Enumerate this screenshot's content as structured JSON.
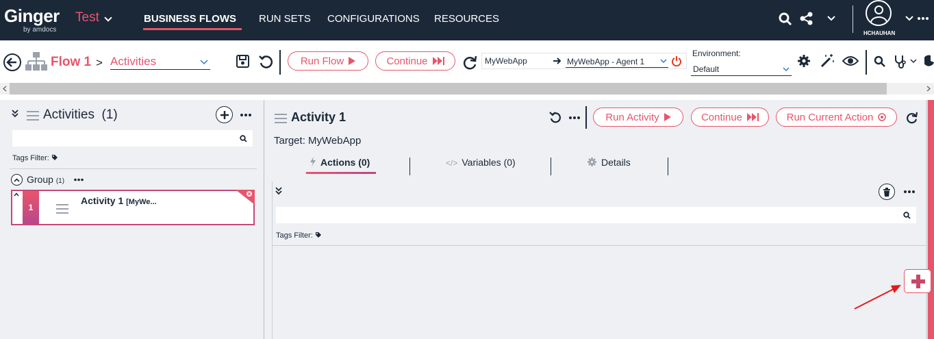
{
  "app": {
    "logo": "Ginger",
    "logo_sub": "by amdocs",
    "solution": "Test",
    "username": "HCHAUHAN",
    "accent": "#e8556b",
    "nav_bg": "#1b2838"
  },
  "nav": {
    "items": [
      "BUSINESS FLOWS",
      "RUN SETS",
      "CONFIGURATIONS",
      "RESOURCES"
    ],
    "active": "BUSINESS FLOWS"
  },
  "toolbar": {
    "flow_name": "Flow 1",
    "crumb_sep": ">",
    "view_select": "Activities",
    "run_flow": "Run Flow",
    "continue": "Continue",
    "target_app": "MyWebApp",
    "agent": "MyWebApp - Agent 1",
    "env_label": "Environment:",
    "env_value": "Default"
  },
  "activities_panel": {
    "title": "Activities",
    "count": "(1)",
    "tags_filter": "Tags Filter:",
    "group_name": "Group",
    "group_count": "(1)",
    "items": [
      {
        "number": "1",
        "name": "Activity 1",
        "target": "[MyWe..."
      }
    ]
  },
  "activity": {
    "title": "Activity 1",
    "target": "Target: MyWebApp",
    "run_activity": "Run Activity",
    "continue": "Continue",
    "run_current_action": "Run Current Action",
    "tabs": [
      {
        "label": "Actions (0)",
        "active": true
      },
      {
        "label": "Variables (0)",
        "active": false
      },
      {
        "label": "Details",
        "active": false
      }
    ],
    "tags_filter": "Tags Filter:"
  },
  "icons": [
    "search-icon",
    "share-icon",
    "chevron-down-icon",
    "user-icon",
    "back-icon",
    "flow-icon",
    "save-icon",
    "undo-icon",
    "refresh-icon",
    "power-icon",
    "gear-icon",
    "wand-icon",
    "eye-icon",
    "stethoscope-icon",
    "pie-icon",
    "add-icon",
    "trash-icon",
    "tag-icon",
    "bolt-icon",
    "code-icon",
    "collapse-icon",
    "plus-icon"
  ]
}
